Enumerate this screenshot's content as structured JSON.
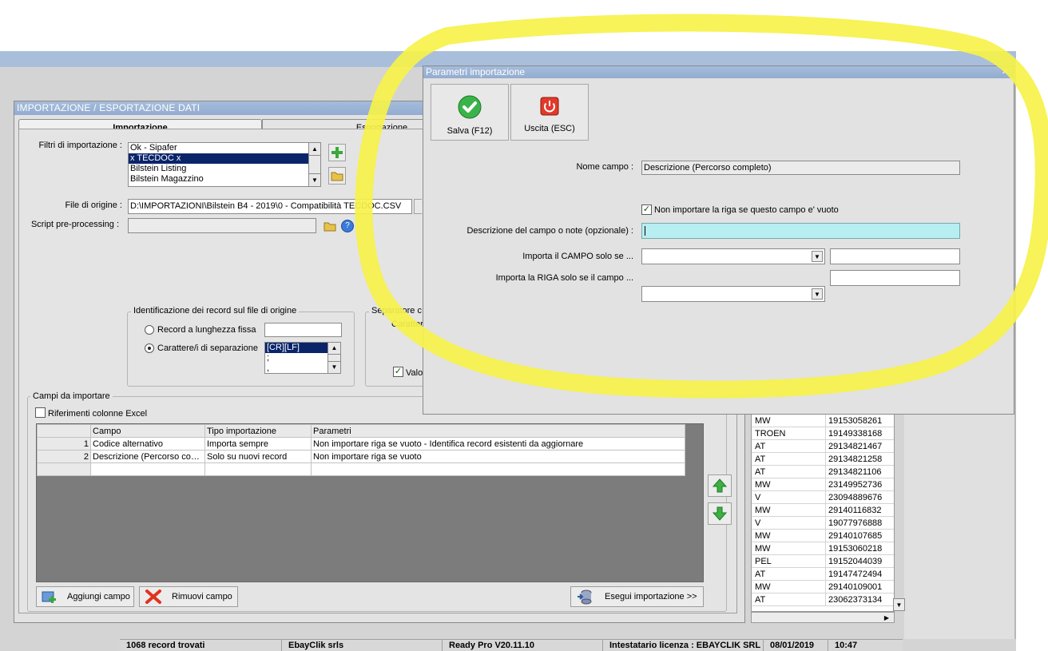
{
  "main_window": {
    "title": "IMPORTAZIONE / ESPORTAZIONE DATI",
    "tabs": [
      {
        "label": "Importazione"
      },
      {
        "label": "Esportazione"
      }
    ]
  },
  "import": {
    "filters_label": "Filtri di importazione :",
    "filters": [
      "Ok - Sipafer",
      "x TECDOC x",
      "Bilstein Listing",
      "Bilstein Magazzino"
    ],
    "selected_filter": "x TECDOC x",
    "source_file_label": "File di origine :",
    "source_file_value": "D:\\IMPORTAZIONI\\Bilstein B4 - 2019\\0 - Compatibilità TECDOC.CSV",
    "script_label": "Script pre-processing :",
    "record_group_title": "Identificazione dei record sul file di origine",
    "fixed_length_label": "Record a lunghezza fissa",
    "separator_chars_label": "Carattere/i di separazione",
    "separator_options": [
      "[CR][LF]",
      ";",
      ","
    ],
    "separator_group_title": "Separatore c",
    "separator_group_sub": "Caratter",
    "valo_label": "Valo",
    "fields_group_title": "Campi da importare",
    "excel_refs_label": "Riferimenti colonne Excel"
  },
  "grid": {
    "headers": [
      "",
      "Campo",
      "Tipo importazione",
      "Parametri"
    ],
    "rows": [
      {
        "n": "1",
        "campo": "Codice alternativo",
        "tipo": "Importa sempre",
        "parametri": "Non importare riga se vuoto - Identifica record esistenti da aggiornare"
      },
      {
        "n": "2",
        "campo": "Descrizione (Percorso com…",
        "tipo": "Solo su nuovi record",
        "parametri": "Non importare riga se vuoto"
      }
    ]
  },
  "buttons": {
    "add_field": "Aggiungi campo",
    "remove_field": "Rimuovi campo",
    "run_import": "Esegui importazione >>"
  },
  "right_list": [
    {
      "a": "MW",
      "b": "19153058261"
    },
    {
      "a": "TROEN",
      "b": "19149338168"
    },
    {
      "a": "AT",
      "b": "29134821467"
    },
    {
      "a": "AT",
      "b": "29134821258"
    },
    {
      "a": "AT",
      "b": "29134821106"
    },
    {
      "a": "MW",
      "b": "23149952736"
    },
    {
      "a": "V",
      "b": "23094889676"
    },
    {
      "a": "MW",
      "b": "29140116832"
    },
    {
      "a": "V",
      "b": "19077976888"
    },
    {
      "a": "MW",
      "b": "29140107685"
    },
    {
      "a": "MW",
      "b": "19153060218"
    },
    {
      "a": "PEL",
      "b": "19152044039"
    },
    {
      "a": "AT",
      "b": "19147472494"
    },
    {
      "a": "MW",
      "b": "29140109001"
    },
    {
      "a": "AT",
      "b": "23062373134"
    }
  ],
  "status_bar": {
    "records": "1068 record trovati",
    "company": "EbayClik srls",
    "version": "Ready Pro V20.11.10",
    "license": "Intestatario licenza : EBAYCLIK SRL",
    "date": "08/01/2019",
    "time": "10:47"
  },
  "dialog": {
    "title": "Parametri importazione",
    "save_label": "Salva (F12)",
    "exit_label": "Uscita (ESC)",
    "field_name_label": "Nome campo :",
    "field_name_value": "Descrizione (Percorso completo)",
    "skip_empty_label": "Non importare la riga se questo campo e' vuoto",
    "skip_empty_checked": true,
    "notes_label": "Descrizione del campo o note (opzionale) :",
    "import_field_if_label": "Importa il CAMPO solo se ...",
    "import_row_if_label": "Importa la RIGA solo se il campo ...",
    "close_glyph": "✕"
  },
  "colors": {
    "title_bar": "#9db6d8",
    "selection": "#0a246a",
    "notes_input": "#b7eef2",
    "highlight": "#f6f24a"
  }
}
